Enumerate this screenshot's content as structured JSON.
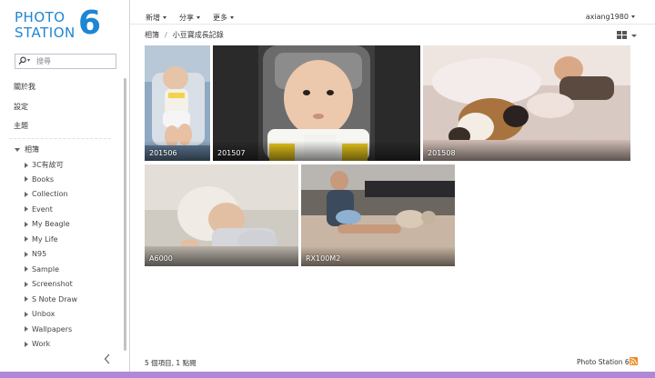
{
  "app": {
    "logo_line1": "PHOTO",
    "logo_line2": "STATION",
    "logo_digit": "6",
    "brand_color": "#1e86d3"
  },
  "search": {
    "placeholder": "搜尋",
    "icon": "search-icon"
  },
  "sidebar": {
    "menu": [
      {
        "label": "關於我"
      },
      {
        "label": "設定"
      },
      {
        "label": "主題"
      }
    ],
    "tree_root": "相簿",
    "albums": [
      "3C有故可",
      "Books",
      "Collection",
      "Event",
      "My Beagle",
      "My Life",
      "N95",
      "Sample",
      "Screenshot",
      "S Note Draw",
      "Unbox",
      "Wallpapers",
      "Work"
    ]
  },
  "topbar": {
    "new_label": "新增",
    "share_label": "分享",
    "more_label": "更多",
    "user": "axiang1980"
  },
  "breadcrumb": {
    "root": "相簿",
    "sep": "/",
    "current": "小豆寶成長記錄"
  },
  "photos": [
    {
      "caption": "201506"
    },
    {
      "caption": "201507"
    },
    {
      "caption": "201508"
    },
    {
      "caption": "A6000"
    },
    {
      "caption": "RX100M2"
    }
  ],
  "footer": {
    "count": "5 個項目, 1 點閱",
    "brand": "Photo Station 6"
  }
}
